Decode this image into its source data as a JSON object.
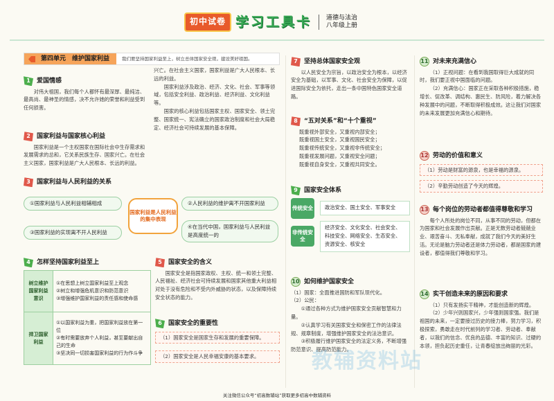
{
  "header": {
    "badge": "初中试卷",
    "title": "学习工具卡",
    "subject": "道德与法治",
    "grade": "八年级上册"
  },
  "unit": {
    "label": "第四单元　维护国家利益",
    "desc": "我们要坚持国家利益至上，树立总体国家安全观，建设美好祖国。"
  },
  "s1": {
    "num": "1",
    "title": "爱国情感",
    "text": "对伟大祖国，我们每个人都怀有最深厚、最纯洁、最高尚、最神圣的情感，决不允许她的荣誉和利益受到任何损害。"
  },
  "s2": {
    "num": "2",
    "title": "国家利益与国家核心利益",
    "text": "国家利益是一个主权国家在国际社会中生存需求和发展需求的总和，它关系民族生存、国家兴亡。在社会主义国家，国家利益是广大人民根本、长远的利益。",
    "text2": "国家利益涉及政治、经济、文化、社会、军事等领域，包括安全利益、政治利益、经济利益、文化利益等。",
    "text3": "国家的核心利益包括国家主权、国家安全、领土完整、国家统一、宪法确立的国家政治制度和社会大局稳定、经济社会可持续发展的基本保障。"
  },
  "s3": {
    "num": "3",
    "title": "国家利益与人民利益的关系",
    "c1": "①国家利益与人民利益相辅相成",
    "c2": "②人民利益的维护离不开国家利益",
    "c3": "③国家利益的实现离不开人民利益",
    "c4": "④在当代中国，国家利益与人民利益是高度统一的",
    "center": "国家利益是人民利益的集中表现"
  },
  "s4": {
    "num": "4",
    "title": "怎样坚持国家利益至上",
    "h1": "树立维护国家利益意识",
    "r1": "①在思想上树立国家利益至上观念\n②树立和增强危机意识和防范意识\n③增强维护国家利益的责任感和使命感",
    "h2": "捍卫国家利益",
    "r2": "①以国家利益为重，把国家利益放在第一位\n②有时需要放弃个人利益，甚至要献出自己的生命\n③坚决同一切损害国家利益的行为作斗争"
  },
  "s5": {
    "num": "5",
    "title": "国家安全的含义",
    "text": "国家安全是指国家政权、主权、统一和领土完整、人民福祉、经济社会可持续发展和国家其他重大利益相对处于没有危险和不受内外威胁的状态，以及保障持续安全状态的能力。"
  },
  "s6": {
    "num": "6",
    "title": "国家安全的重要性",
    "t1": "（1）国家安全是国家生存和发展的重要保障。",
    "t2": "（2）国家安全是人民幸福安康的基本要求。"
  },
  "s7": {
    "num": "7",
    "title": "坚持总体国家安全观",
    "text": "以人民安全为宗旨，以政治安全为根本，以经济安全为基础，以军事、文化、社会安全为保障，以促进国际安全为依托，走出一条中国特色国家安全道路。"
  },
  "s8": {
    "num": "8",
    "title": "“五对关系”和“十个重视”",
    "lines": [
      "既重视外部安全，又重视内部安全；",
      "既重视国土安全，又重视国民安全；",
      "既重视传统安全，又重视非传统安全；",
      "既重视发展问题，又重视安全问题；",
      "既重视自身安全，又重视共同安全。"
    ]
  },
  "s9": {
    "num": "9",
    "title": "国家安全体系",
    "tag1": "传统安全",
    "text1": "政治安全、国土安全、军事安全",
    "tag2": "非传统安全",
    "text2": "经济安全、文化安全、社会安全、科技安全、网络安全、生态安全、资源安全、核安全"
  },
  "s10": {
    "num": "10",
    "title": "如何维护国家安全",
    "lines": [
      "（1）国家：全面推进国防和军队现代化。",
      "（2）公民：",
      "①通过各种方式为维护国家安全贡献智慧和力量。",
      "②认真学习有关国家安全和保密工作的法律法规、规章制度，增强维护国家安全的法治意识。",
      "③积极履行维护国家安全的法定义务，不断增强防范意识、提高防范能力。"
    ]
  },
  "s11": {
    "num": "11",
    "title": "对未来充满信心",
    "t1": "（1）正视问题：在看到我国取得巨大成就的同时，我们要正视中国面临的问题。",
    "t2": "（2）充满信心：国家正在采取各种积极措施，稳增长、促改革、调结构、惠民生、防风险，着力解决各种发展中的问题，不断取得积极成效。这让我们对国家的未来发展更加充满信心和期待。"
  },
  "s12": {
    "num": "12",
    "title": "劳动的价值和意义",
    "t1": "（1）劳动是财富的源泉，也是幸福的源泉。",
    "t2": "（2）辛勤劳动创造了今天的辉煌。"
  },
  "s13": {
    "num": "13",
    "title": "每个岗位的劳动者都值得尊敬和学习",
    "text": "每个人所处的岗位不同，从事不同的劳动，但都在为国家和社会发展作出贡献。正是无数劳动者兢兢业业、艰苦奋斗、无私奉献，成就了我们今天的美好生活。无论是脑力劳动者还是体力劳动者，都是国家的建设者，都值得我们尊敬和学习。"
  },
  "s14": {
    "num": "14",
    "title": "实干创造未来的原因和要求",
    "t1": "（1）只有发扬实干精神，才能创造新的辉煌。",
    "t2": "（2）少年兴则国家兴，少年强则国家强。我们是祖国的未来，一定要接过历史的接力棒，努力学习，积极探索，勇敢走在时代前列的学习者、劳动者、奉献者，以我们的信念、优良的品德、丰富的知识、过硬的本领，担负起历史重任，让青春绽放出绚丽的光彩。"
  },
  "watermark": "教辅资料站",
  "footer": "关注微信公众号“初高数辅站”获取更多初高中数辅资料"
}
